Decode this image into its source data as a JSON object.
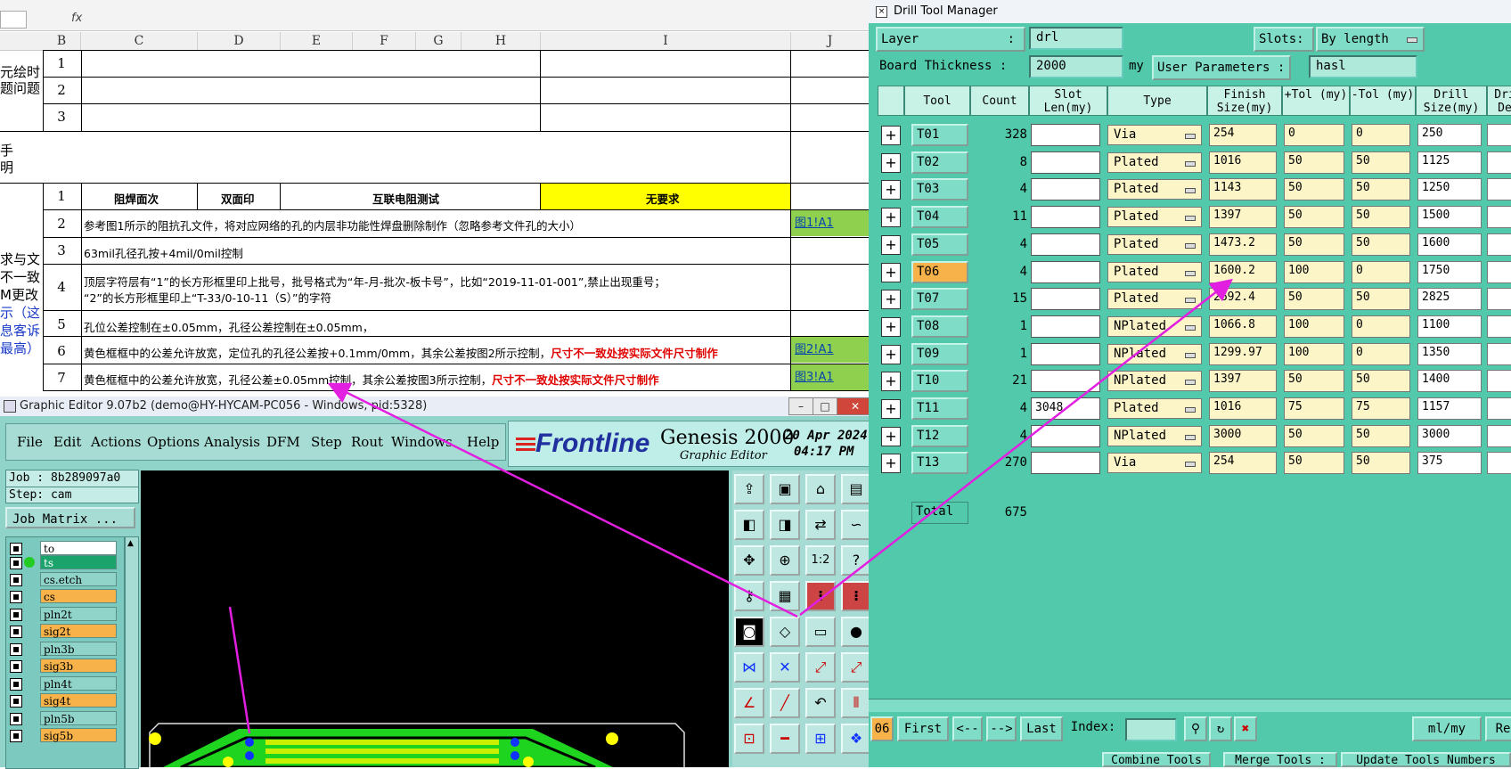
{
  "sheet": {
    "columns": [
      "B",
      "C",
      "D",
      "E",
      "F",
      "G",
      "H",
      "I",
      "J"
    ],
    "side_labels": [
      "元绘时",
      "题问题",
      "手",
      "明",
      "求与文",
      "不一致",
      "M更改",
      "示（这",
      "息客诉",
      "最高）"
    ],
    "rows_top": [
      "1",
      "2",
      "3"
    ],
    "rows_main": [
      {
        "n": "1"
      },
      {
        "n": "2",
        "text": "参考图1所示的阻抗孔文件，将对应网络的孔的内层非功能性焊盘删除制作（忽略参考文件孔的大小）",
        "link": "图1!A1"
      },
      {
        "n": "3",
        "text": "63mil孔径孔按+4mil/0mil控制"
      },
      {
        "n": "4",
        "text": "顶层字符层有“1”的长方形框里印上批号，批号格式为“年-月-批次-板卡号”，比如“2019-11-01-001”,禁止出现重号；",
        "text2": "“2”的长方形框里印上“T-33/0-10-11（S）”的字符"
      },
      {
        "n": "5",
        "text": "孔位公差控制在±0.05mm，孔径公差控制在±0.05mm，"
      },
      {
        "n": "6",
        "text": "黄色框框中的公差允许放宽，定位孔的孔径公差按+0.1mm/0mm，其余公差按图2所示控制，",
        "red": "尺寸不一致处按实际文件尺寸制作",
        "link": "图2!A1"
      },
      {
        "n": "7",
        "text": "黄色框框中的公差允许放宽，孔径公差±0.05mm控制，其余公差按图3所示控制，",
        "red": "尺寸不一致处按实际文件尺寸制作",
        "link": "图3!A1"
      }
    ],
    "row1_cells": [
      "阻焊面次",
      "双面印",
      "互联电阻测试",
      "无要求"
    ],
    "fx": "fx"
  },
  "ge": {
    "title": "Graphic Editor 9.07b2 (demo@HY-HYCAM-PC056 - Windows, pid:5328)",
    "menu": [
      "File",
      "Edit",
      "Actions",
      "Options",
      "Analysis",
      "DFM",
      "Step",
      "Rout",
      "Windows",
      "Help"
    ],
    "logo": "Frontline",
    "product": "Genesis 2000",
    "product_sub": "Graphic Editor",
    "date": "20 Apr 2024",
    "time": "04:17 PM",
    "job": "Job : 8b289097a0",
    "step": "Step: cam",
    "job_matrix": "Job Matrix ...",
    "layers": [
      {
        "name": "to",
        "color": "#ffffff"
      },
      {
        "name": "ts",
        "color": "#1aa36b"
      },
      {
        "name": "cs.etch",
        "color": "#8fd3c9"
      },
      {
        "name": "cs",
        "color": "#f7b24a"
      },
      {
        "name": "pln2t",
        "color": "#8fd3c9"
      },
      {
        "name": "sig2t",
        "color": "#f7b24a"
      },
      {
        "name": "pln3b",
        "color": "#8fd3c9"
      },
      {
        "name": "sig3b",
        "color": "#f7b24a"
      },
      {
        "name": "pln4t",
        "color": "#8fd3c9"
      },
      {
        "name": "sig4t",
        "color": "#f7b24a"
      },
      {
        "name": "pln5b",
        "color": "#8fd3c9"
      },
      {
        "name": "sig5b",
        "color": "#f7b24a"
      }
    ],
    "tool_labels": [
      "1:2",
      "?"
    ]
  },
  "dtm": {
    "title": "Drill Tool Manager",
    "layer_label": "Layer",
    "layer_value": "drl",
    "slots_label": "Slots:",
    "slots_value": "By length",
    "thickness_label": "Board Thickness :",
    "thickness_value": "2000",
    "thickness_unit": "my",
    "user_params_label": "User Parameters :",
    "user_params_value": "hasl",
    "headers": [
      "Tool",
      "Count",
      "Slot Len(my)",
      "Type",
      "Finish Size(my)",
      "+Tol (my)",
      "-Tol (my)",
      "Drill Size(my)",
      "Dri De"
    ],
    "rows": [
      {
        "tool": "T01",
        "count": "328",
        "slot": "",
        "type": "Via",
        "finish": "254",
        "ptol": "0",
        "mtol": "0",
        "drill": "250"
      },
      {
        "tool": "T02",
        "count": "8",
        "slot": "",
        "type": "Plated",
        "finish": "1016",
        "ptol": "50",
        "mtol": "50",
        "drill": "1125"
      },
      {
        "tool": "T03",
        "count": "4",
        "slot": "",
        "type": "Plated",
        "finish": "1143",
        "ptol": "50",
        "mtol": "50",
        "drill": "1250"
      },
      {
        "tool": "T04",
        "count": "11",
        "slot": "",
        "type": "Plated",
        "finish": "1397",
        "ptol": "50",
        "mtol": "50",
        "drill": "1500"
      },
      {
        "tool": "T05",
        "count": "4",
        "slot": "",
        "type": "Plated",
        "finish": "1473.2",
        "ptol": "50",
        "mtol": "50",
        "drill": "1600"
      },
      {
        "tool": "T06",
        "count": "4",
        "slot": "",
        "type": "Plated",
        "finish": "1600.2",
        "ptol": "100",
        "mtol": "0",
        "drill": "1750"
      },
      {
        "tool": "T07",
        "count": "15",
        "slot": "",
        "type": "Plated",
        "finish": "2692.4",
        "ptol": "50",
        "mtol": "50",
        "drill": "2825"
      },
      {
        "tool": "T08",
        "count": "1",
        "slot": "",
        "type": "NPlated",
        "finish": "1066.8",
        "ptol": "100",
        "mtol": "0",
        "drill": "1100"
      },
      {
        "tool": "T09",
        "count": "1",
        "slot": "",
        "type": "NPlated",
        "finish": "1299.97",
        "ptol": "100",
        "mtol": "0",
        "drill": "1350"
      },
      {
        "tool": "T10",
        "count": "21",
        "slot": "",
        "type": "NPlated",
        "finish": "1397",
        "ptol": "50",
        "mtol": "50",
        "drill": "1400"
      },
      {
        "tool": "T11",
        "count": "4",
        "slot": "3048",
        "type": "Plated",
        "finish": "1016",
        "ptol": "75",
        "mtol": "75",
        "drill": "1157"
      },
      {
        "tool": "T12",
        "count": "4",
        "slot": "",
        "type": "NPlated",
        "finish": "3000",
        "ptol": "50",
        "mtol": "50",
        "drill": "3000"
      },
      {
        "tool": "T13",
        "count": "270",
        "slot": "",
        "type": "Via",
        "finish": "254",
        "ptol": "50",
        "mtol": "50",
        "drill": "375"
      }
    ],
    "total_label": "Total",
    "total_value": "675",
    "nav": {
      "current": "06",
      "first": "First",
      "prev": "<--",
      "next": "-->",
      "last": "Last",
      "index_label": "Index:",
      "units": "ml/my",
      "re": "Re"
    },
    "bottom_buttons": [
      "Combine Tools",
      "Merge Tools :",
      "Update Tools Numbers"
    ]
  },
  "colors": {
    "arrow": "#e21ee0",
    "dtm_bg": "#52c9aa",
    "ge_bg": "#8fd3c9",
    "selected": "#f7b24a"
  }
}
